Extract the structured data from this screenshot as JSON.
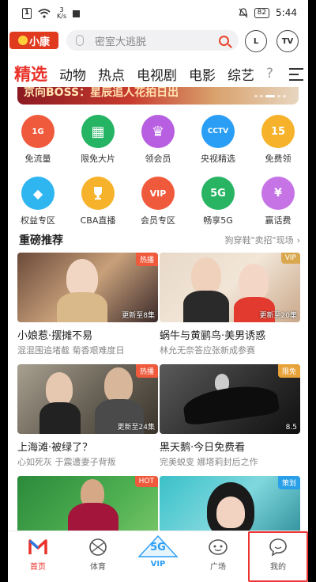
{
  "status_bar": {
    "sim_label": "1",
    "speed_value": "3",
    "speed_unit": "K/s",
    "battery": "82",
    "time": "5:44"
  },
  "header": {
    "logo_text": "小康",
    "search_placeholder": "密室大逃脱",
    "profile_button": "L",
    "tv_button": "TV"
  },
  "tabs": [
    "精选",
    "动物",
    "热点",
    "电视剧",
    "电影",
    "综艺",
    "?"
  ],
  "banner": {
    "text": "京向BOSS：星辰追人花拍日出"
  },
  "grid": [
    [
      {
        "label": "免流量",
        "icon": "free-data-icon",
        "color": "#f05a3c",
        "glyph": "1G"
      },
      {
        "label": "限免大片",
        "icon": "film-icon",
        "color": "#25b364",
        "glyph": "▦"
      },
      {
        "label": "领会员",
        "icon": "crown-icon",
        "color": "#b75fe0",
        "glyph": "♛"
      },
      {
        "label": "央视精选",
        "icon": "cctv-icon",
        "color": "#2a9df4",
        "glyph": "CCTV"
      },
      {
        "label": "免费领",
        "icon": "calendar-icon",
        "color": "#f6b22a",
        "glyph": "15"
      }
    ],
    [
      {
        "label": "权益专区",
        "icon": "ticket-icon",
        "color": "#2fb6f0",
        "glyph": "◆"
      },
      {
        "label": "CBA直播",
        "icon": "trophy-icon",
        "color": "#f6b22a",
        "glyph": "🏆"
      },
      {
        "label": "会员专区",
        "icon": "vip-icon",
        "color": "#f05a3c",
        "glyph": "VIP"
      },
      {
        "label": "畅享5G",
        "icon": "5g-icon",
        "color": "#28b463",
        "glyph": "5G"
      },
      {
        "label": "赢话费",
        "icon": "phone-icon",
        "color": "#c673e6",
        "glyph": "¥"
      }
    ]
  ],
  "section": {
    "title": "重磅推荐",
    "more": "狗穿鞋\"卖招\"现场"
  },
  "cards": [
    {
      "title": "小娘惹·摆摊不易",
      "subtitle": "混混围追堵截 菊香艰难度日",
      "tag": "热播",
      "tag_color": "#f05a3c",
      "update": "更新至8集"
    },
    {
      "title": "蜗牛与黄鹂鸟·美男诱惑",
      "subtitle": "林允无奈答应张新成参赛",
      "tag": "VIP",
      "tag_color": "#d9a84e",
      "update": "更新至20集"
    },
    {
      "title": "上海滩·被绿了？",
      "subtitle": "心如死灰 于震遭妻子背叛",
      "tag": "热播",
      "tag_color": "#f05a3c",
      "update": "更新至24集"
    },
    {
      "title": "黑天鹅·今日免费看",
      "subtitle": "完美蜕变 娜塔莉封后之作",
      "tag": "限免",
      "tag_color": "#e8a23a",
      "update": "8.5"
    },
    {
      "title": "",
      "subtitle": "",
      "tag": "HOT",
      "tag_color": "#f05a3c",
      "update": ""
    },
    {
      "title": "",
      "subtitle": "",
      "tag": "策划",
      "tag_color": "#2aa0e8",
      "update": ""
    }
  ],
  "bottom_nav": [
    {
      "label": "首页",
      "icon": "home-logo-icon",
      "active": true
    },
    {
      "label": "体育",
      "icon": "ball-icon",
      "active": false
    },
    {
      "label": "VIP",
      "icon": "5g-vip-icon",
      "active": false
    },
    {
      "label": "广场",
      "icon": "square-face-icon",
      "active": false
    },
    {
      "label": "我的",
      "icon": "chat-bubble-icon",
      "active": false
    }
  ]
}
